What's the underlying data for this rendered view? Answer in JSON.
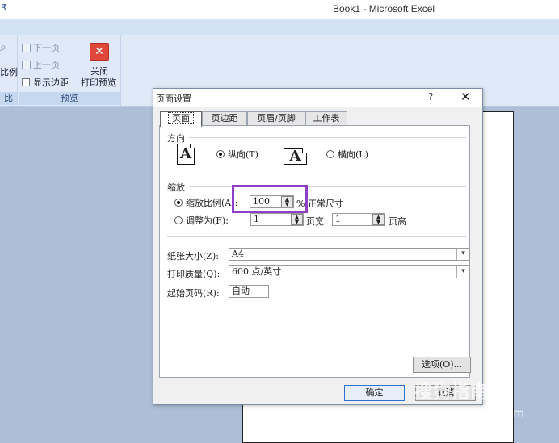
{
  "window": {
    "qat_glyph": "₹",
    "title": "Book1 - Microsoft Excel"
  },
  "ribbon": {
    "zoom_group": {
      "button_label": "比例",
      "group_label": "比例"
    },
    "preview_group": {
      "next_page": "下一页",
      "prev_page": "上一页",
      "show_margins": "显示边距",
      "close_line1": "关闭",
      "close_line2": "打印预览",
      "close_glyph": "✕",
      "group_label": "预览"
    }
  },
  "dialog": {
    "title": "页面设置",
    "help": "?",
    "close": "✕",
    "tabs": [
      {
        "label": "页面"
      },
      {
        "label": "页边距"
      },
      {
        "label": "页眉/页脚"
      },
      {
        "label": "工作表"
      }
    ],
    "orientation": {
      "section": "方向",
      "portrait": "纵向(T)",
      "landscape": "横向(L)",
      "icon_glyph": "A",
      "selected": "portrait"
    },
    "scaling": {
      "section": "缩放",
      "adjust_to_label": "缩放比例(A):",
      "adjust_to_value": "100",
      "percent_label": "% 正常尺寸",
      "fit_to_label": "调整为(F):",
      "fit_wide_value": "1",
      "fit_wide_label": "页宽",
      "fit_tall_value": "1",
      "fit_tall_label": "页高",
      "selected": "adjust"
    },
    "paper_size": {
      "label": "纸张大小(Z):",
      "value": "A4"
    },
    "print_quality": {
      "label": "打印质量(Q):",
      "value": "600 点/英寸"
    },
    "first_page_number": {
      "label": "起始页码(R):",
      "value": "自动"
    },
    "options_button": "选项(O)...",
    "ok_button": "确定",
    "cancel_button": "取消"
  },
  "watermark": {
    "line1": "搜狗指南",
    "line2": "zhinan.sogou.com"
  },
  "colors": {
    "highlight": "#8e3ec7",
    "close_button": "#e0483b",
    "ribbon": "#dfe9f7"
  }
}
